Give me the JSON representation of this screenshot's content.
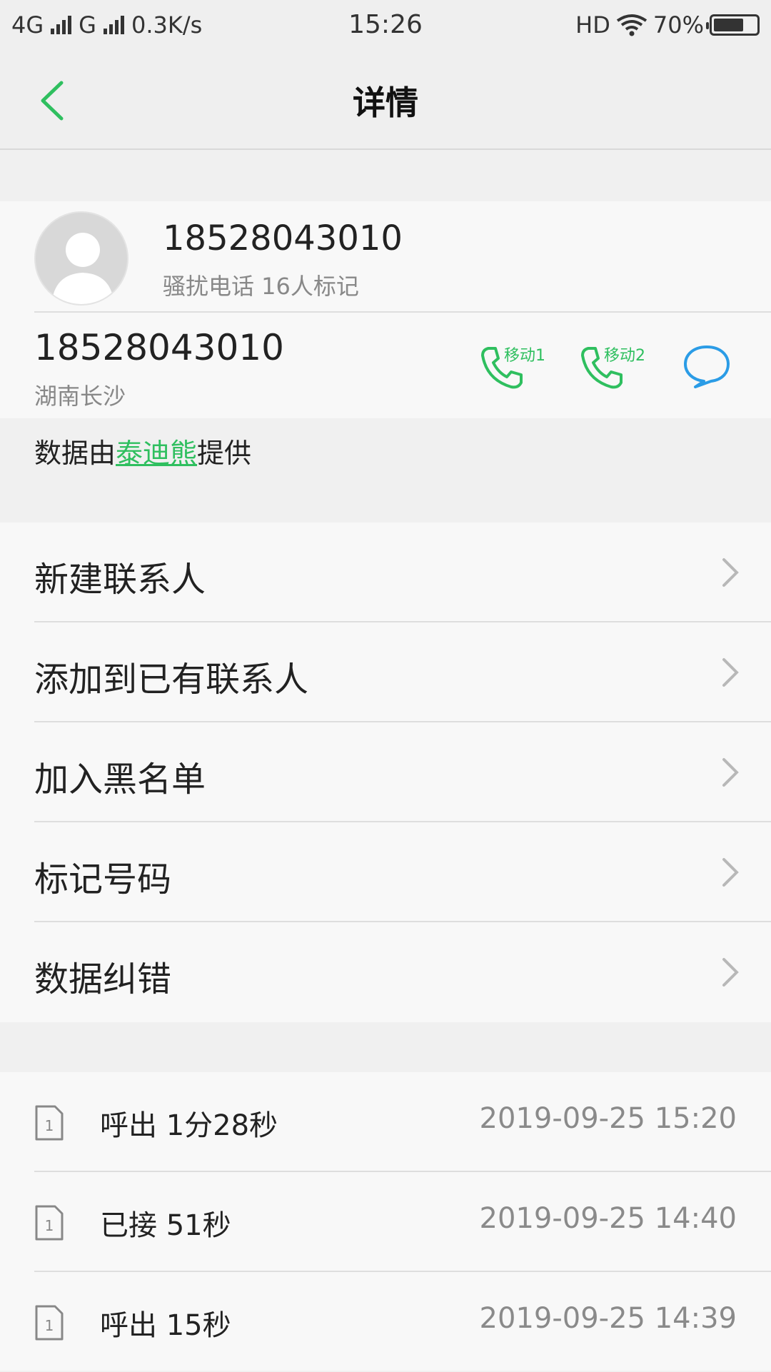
{
  "status_bar": {
    "network1": "4G",
    "network2": "G",
    "speed": "0.3K/s",
    "time": "15:26",
    "hd": "HD",
    "battery": "70%",
    "battery_level": 0.7
  },
  "header": {
    "title": "详情",
    "back_icon": "chevron-left-icon"
  },
  "profile": {
    "number": "18528043010",
    "tag": "骚扰电话 16人标记",
    "number_secondary": "18528043010",
    "location": "湖南长沙",
    "call_sim1_label": "移动1",
    "call_sim2_label": "移动2",
    "accent_color": "#2fbf5f",
    "message_color": "#2b9ce6"
  },
  "source": {
    "prefix": "数据由",
    "provider": "泰迪熊",
    "suffix": "提供"
  },
  "menu": {
    "items": [
      {
        "label": "新建联系人"
      },
      {
        "label": "添加到已有联系人"
      },
      {
        "label": "加入黑名单"
      },
      {
        "label": "标记号码"
      },
      {
        "label": "数据纠错"
      }
    ]
  },
  "calls": {
    "items": [
      {
        "sim": "1",
        "desc": "呼出 1分28秒",
        "time": "2019-09-25 15:20"
      },
      {
        "sim": "1",
        "desc": "已接 51秒",
        "time": "2019-09-25 14:40"
      },
      {
        "sim": "1",
        "desc": "呼出 15秒",
        "time": "2019-09-25 14:39"
      }
    ]
  }
}
